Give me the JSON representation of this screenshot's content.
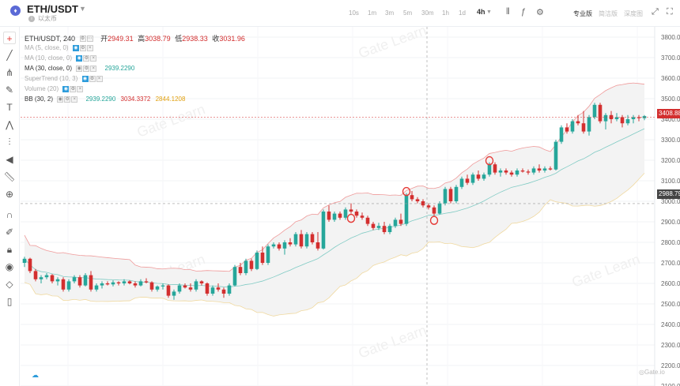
{
  "header": {
    "coin_icon": "ethereum-icon",
    "pair": "ETH/USDT",
    "subtitle": "以太币",
    "intervals": [
      "10s",
      "1m",
      "3m",
      "5m",
      "30m",
      "1h",
      "1d",
      "4h"
    ],
    "active_interval": "4h",
    "views": [
      "专业版",
      "简洁版",
      "深度图"
    ],
    "active_view": "专业版",
    "icons": [
      "candle-type-icon",
      "indicators-icon",
      "settings-icon",
      "fullscreen-icon",
      "expand-icon"
    ]
  },
  "toolbar": {
    "tools": [
      "crosshair-icon",
      "trend-line-icon",
      "pitchfork-icon",
      "brush-icon",
      "text-icon",
      "pattern-icon",
      "measure-icon",
      "back-icon",
      "ruler-icon",
      "zoom-in-icon",
      "magnet-icon",
      "lock-drawing-icon",
      "lock-icon",
      "eye-icon",
      "layers-icon",
      "trash-icon"
    ]
  },
  "legend": {
    "main": {
      "name": "ETH/USDT, 240",
      "open_label": "开",
      "open": "2949.31",
      "high_label": "高",
      "high": "3038.79",
      "low_label": "低",
      "low": "2938.33",
      "close_label": "收",
      "close": "3031.96"
    },
    "ma5": {
      "name": "MA (5, close, 0)"
    },
    "ma10": {
      "name": "MA (10, close, 0)"
    },
    "ma30": {
      "name": "MA (30, close, 0)",
      "value": "2939.2290"
    },
    "supertrend": {
      "name": "SuperTrend (10, 3)"
    },
    "volume": {
      "name": "Volume (20)"
    },
    "bb": {
      "name": "BB (30, 2)",
      "basis": "2939.2290",
      "upper": "3034.3372",
      "lower": "2844.1208"
    }
  },
  "price_axis": {
    "labels": [
      "3800.00",
      "3700.00",
      "3600.00",
      "3500.00",
      "3400.00",
      "3300.00",
      "3200.00",
      "3100.00",
      "3000.00",
      "2900.00",
      "2800.00",
      "2700.00",
      "2600.00",
      "2500.00",
      "2400.00",
      "2300.00",
      "2200.00",
      "2100.00"
    ],
    "last_price": "3408.88",
    "crosshair_price": "2988.79"
  },
  "colors": {
    "up": "#26a69a",
    "down": "#d32f2f",
    "bb_upper": "#ef9a9a",
    "bb_lower": "#f0d9a0",
    "basis": "#80cbc4",
    "band_fill": "#f3f3f3"
  },
  "watermark": "Gate Learn",
  "chart_data": {
    "type": "candlestick",
    "title": "ETH/USDT, 240",
    "ylim": [
      2100,
      3850
    ],
    "candles": [
      [
        2700,
        2730,
        2680,
        2720
      ],
      [
        2720,
        2725,
        2650,
        2660
      ],
      [
        2660,
        2670,
        2610,
        2620
      ],
      [
        2620,
        2640,
        2600,
        2630
      ],
      [
        2630,
        2650,
        2620,
        2640
      ],
      [
        2640,
        2645,
        2600,
        2610
      ],
      [
        2610,
        2630,
        2590,
        2620
      ],
      [
        2620,
        2630,
        2560,
        2570
      ],
      [
        2570,
        2620,
        2560,
        2610
      ],
      [
        2610,
        2640,
        2600,
        2630
      ],
      [
        2630,
        2640,
        2580,
        2590
      ],
      [
        2590,
        2650,
        2585,
        2640
      ],
      [
        2640,
        2660,
        2560,
        2570
      ],
      [
        2570,
        2600,
        2560,
        2590
      ],
      [
        2590,
        2610,
        2575,
        2600
      ],
      [
        2600,
        2610,
        2590,
        2595
      ],
      [
        2595,
        2615,
        2585,
        2605
      ],
      [
        2605,
        2610,
        2590,
        2600
      ],
      [
        2600,
        2620,
        2590,
        2610
      ],
      [
        2610,
        2615,
        2595,
        2600
      ],
      [
        2600,
        2610,
        2580,
        2590
      ],
      [
        2590,
        2620,
        2585,
        2610
      ],
      [
        2610,
        2625,
        2600,
        2605
      ],
      [
        2605,
        2610,
        2560,
        2570
      ],
      [
        2570,
        2590,
        2560,
        2585
      ],
      [
        2585,
        2600,
        2570,
        2590
      ],
      [
        2590,
        2595,
        2530,
        2540
      ],
      [
        2540,
        2570,
        2520,
        2560
      ],
      [
        2560,
        2600,
        2550,
        2590
      ],
      [
        2590,
        2600,
        2575,
        2580
      ],
      [
        2580,
        2600,
        2560,
        2570
      ],
      [
        2570,
        2620,
        2560,
        2610
      ],
      [
        2610,
        2615,
        2590,
        2600
      ],
      [
        2600,
        2605,
        2540,
        2550
      ],
      [
        2550,
        2590,
        2540,
        2580
      ],
      [
        2580,
        2600,
        2560,
        2570
      ],
      [
        2570,
        2580,
        2530,
        2550
      ],
      [
        2550,
        2600,
        2540,
        2590
      ],
      [
        2590,
        2690,
        2585,
        2680
      ],
      [
        2680,
        2700,
        2640,
        2650
      ],
      [
        2650,
        2720,
        2640,
        2710
      ],
      [
        2710,
        2720,
        2660,
        2670
      ],
      [
        2670,
        2760,
        2665,
        2750
      ],
      [
        2750,
        2780,
        2690,
        2700
      ],
      [
        2700,
        2790,
        2690,
        2780
      ],
      [
        2780,
        2800,
        2770,
        2790
      ],
      [
        2790,
        2800,
        2760,
        2770
      ],
      [
        2770,
        2810,
        2740,
        2800
      ],
      [
        2800,
        2820,
        2780,
        2790
      ],
      [
        2790,
        2850,
        2780,
        2840
      ],
      [
        2840,
        2860,
        2770,
        2780
      ],
      [
        2780,
        2850,
        2770,
        2840
      ],
      [
        2840,
        2850,
        2790,
        2800
      ],
      [
        2800,
        2850,
        2760,
        2770
      ],
      [
        2770,
        2960,
        2765,
        2950
      ],
      [
        2950,
        2980,
        2900,
        2910
      ],
      [
        2910,
        2950,
        2900,
        2940
      ],
      [
        2940,
        2950,
        2910,
        2920
      ],
      [
        2920,
        2970,
        2910,
        2960
      ],
      [
        2960,
        2990,
        2940,
        2950
      ],
      [
        2950,
        2960,
        2920,
        2930
      ],
      [
        2930,
        2945,
        2910,
        2920
      ],
      [
        2920,
        2930,
        2880,
        2890
      ],
      [
        2890,
        2900,
        2860,
        2870
      ],
      [
        2870,
        2895,
        2860,
        2880
      ],
      [
        2880,
        2900,
        2840,
        2850
      ],
      [
        2850,
        2890,
        2840,
        2880
      ],
      [
        2880,
        2920,
        2870,
        2910
      ],
      [
        2910,
        2940,
        2880,
        2890
      ],
      [
        2890,
        3040,
        2880,
        3030
      ],
      [
        3030,
        3050,
        3000,
        3010
      ],
      [
        3010,
        3020,
        2990,
        3000
      ],
      [
        3000,
        3010,
        2970,
        2980
      ],
      [
        2980,
        2990,
        2960,
        2970
      ],
      [
        2970,
        2980,
        2930,
        2940
      ],
      [
        2940,
        3000,
        2935,
        2990
      ],
      [
        2990,
        3070,
        2980,
        3060
      ],
      [
        3060,
        3070,
        2990,
        3000
      ],
      [
        3000,
        3080,
        2990,
        3070
      ],
      [
        3070,
        3120,
        3060,
        3110
      ],
      [
        3110,
        3130,
        3080,
        3090
      ],
      [
        3090,
        3140,
        3080,
        3130
      ],
      [
        3130,
        3150,
        3100,
        3110
      ],
      [
        3110,
        3140,
        3100,
        3130
      ],
      [
        3130,
        3190,
        3120,
        3180
      ],
      [
        3180,
        3190,
        3130,
        3140
      ],
      [
        3140,
        3160,
        3120,
        3150
      ],
      [
        3150,
        3160,
        3130,
        3140
      ],
      [
        3140,
        3150,
        3120,
        3130
      ],
      [
        3130,
        3160,
        3120,
        3150
      ],
      [
        3150,
        3160,
        3140,
        3145
      ],
      [
        3145,
        3155,
        3130,
        3140
      ],
      [
        3140,
        3170,
        3130,
        3160
      ],
      [
        3160,
        3180,
        3140,
        3150
      ],
      [
        3150,
        3170,
        3140,
        3160
      ],
      [
        3160,
        3170,
        3150,
        3155
      ],
      [
        3155,
        3300,
        3150,
        3290
      ],
      [
        3290,
        3370,
        3280,
        3360
      ],
      [
        3360,
        3380,
        3330,
        3340
      ],
      [
        3340,
        3400,
        3330,
        3390
      ],
      [
        3390,
        3420,
        3370,
        3380
      ],
      [
        3380,
        3440,
        3330,
        3340
      ],
      [
        3340,
        3420,
        3320,
        3410
      ],
      [
        3410,
        3480,
        3400,
        3470
      ],
      [
        3470,
        3480,
        3380,
        3390
      ],
      [
        3390,
        3430,
        3350,
        3420
      ],
      [
        3420,
        3440,
        3380,
        3400
      ],
      [
        3400,
        3430,
        3390,
        3410
      ],
      [
        3410,
        3420,
        3360,
        3380
      ],
      [
        3380,
        3420,
        3370,
        3400
      ],
      [
        3400,
        3420,
        3380,
        3410
      ],
      [
        3410,
        3420,
        3390,
        3405
      ],
      [
        3405,
        3420,
        3395,
        3415
      ]
    ]
  }
}
